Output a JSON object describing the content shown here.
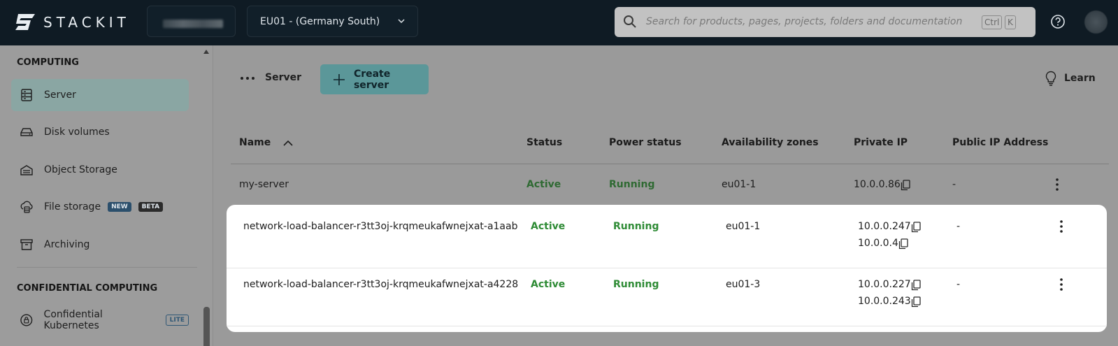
{
  "header": {
    "logo_text": "STACKIT",
    "region": "EU01 - (Germany South)",
    "search_placeholder": "Search for products, pages, projects, folders and documentation",
    "shortcut_ctrl": "Ctrl",
    "shortcut_key": "K"
  },
  "sidebar": {
    "section1": "COMPUTING",
    "items": [
      {
        "label": "Server",
        "active": true
      },
      {
        "label": "Disk volumes"
      },
      {
        "label": "Object Storage"
      },
      {
        "label": "File storage",
        "badges": [
          "NEW",
          "BETA"
        ]
      },
      {
        "label": "Archiving"
      }
    ],
    "section2": "CONFIDENTIAL COMPUTING",
    "items2": [
      {
        "label": "Confidential Kubernetes",
        "badges": [
          "LITE"
        ]
      }
    ]
  },
  "toolbar": {
    "breadcrumb": "Server",
    "create_label": "Create server",
    "learn_label": "Learn"
  },
  "table": {
    "columns": [
      "Name",
      "Status",
      "Power status",
      "Availability zones",
      "Private IP",
      "Public IP Address"
    ],
    "rows": [
      {
        "name": "my-server",
        "status": "Active",
        "power": "Running",
        "zone": "eu01-1",
        "ips": [
          "10.0.0.86"
        ],
        "public": "-"
      },
      {
        "name": "network-load-balancer-r3tt3oj-krqmeukafwnejxat-a1aab",
        "status": "Active",
        "power": "Running",
        "zone": "eu01-1",
        "ips": [
          "10.0.0.247",
          "10.0.0.4"
        ],
        "public": "-"
      },
      {
        "name": "network-load-balancer-r3tt3oj-krqmeukafwnejxat-a4228",
        "status": "Active",
        "power": "Running",
        "zone": "eu01-3",
        "ips": [
          "10.0.0.227",
          "10.0.0.243"
        ],
        "public": "-"
      }
    ]
  },
  "colors": {
    "topbar": "#0f1b24",
    "accent": "#5b9799",
    "active_status": "#2e8b35"
  }
}
